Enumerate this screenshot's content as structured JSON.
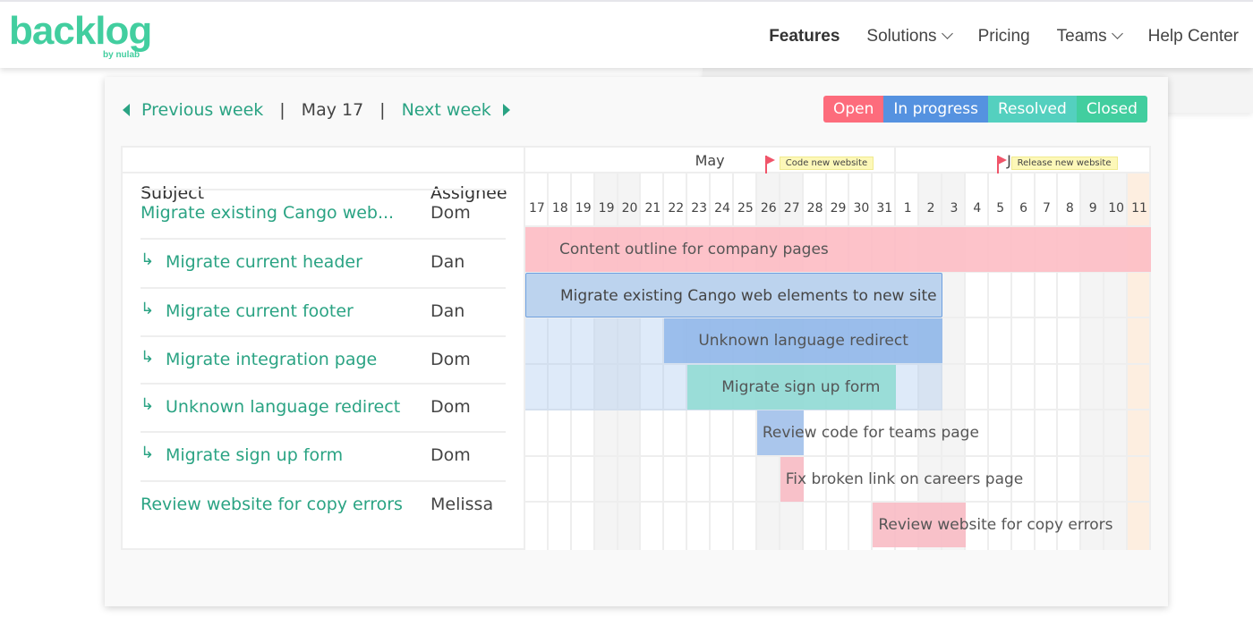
{
  "header": {
    "logo": "backlog",
    "logo_sub": "by nulab",
    "nav": [
      {
        "label": "Features",
        "bold": true
      },
      {
        "label": "Solutions",
        "dropdown": true
      },
      {
        "label": "Pricing"
      },
      {
        "label": "Teams",
        "dropdown": true
      },
      {
        "label": "Help Center"
      }
    ]
  },
  "week_nav": {
    "prev": "Previous week",
    "current": "May 17",
    "next": "Next week",
    "sep": "|"
  },
  "legend": [
    {
      "label": "Open",
      "color": "#fd6c7c"
    },
    {
      "label": "In progress",
      "color": "#5592e0"
    },
    {
      "label": "Resolved",
      "color": "#54d0bf"
    },
    {
      "label": "Closed",
      "color": "#42ce9f"
    }
  ],
  "table": {
    "subject_header": "Subject",
    "assignee_header": "Assignee",
    "rows": [
      {
        "subject": "Migrate existing Cango web...",
        "assignee": "Dom",
        "child": false
      },
      {
        "subject": "Migrate current header",
        "assignee": "Dan",
        "child": true
      },
      {
        "subject": "Migrate current footer",
        "assignee": "Dan",
        "child": true
      },
      {
        "subject": "Migrate integration page",
        "assignee": "Dom",
        "child": true
      },
      {
        "subject": "Unknown language redirect",
        "assignee": "Dom",
        "child": true
      },
      {
        "subject": "Migrate sign up form",
        "assignee": "Dom",
        "child": true
      },
      {
        "subject": "Review website for copy errors",
        "assignee": "Melissa",
        "child": false
      }
    ]
  },
  "timeline": {
    "months": [
      {
        "label": "May",
        "columns": 16
      },
      {
        "label": "June",
        "columns": 11
      }
    ],
    "days": [
      17,
      18,
      19,
      19,
      20,
      21,
      22,
      23,
      24,
      25,
      26,
      27,
      28,
      29,
      30,
      31,
      1,
      2,
      3,
      4,
      5,
      6,
      7,
      8,
      9,
      10,
      11
    ],
    "weekend_columns": [
      "May 19b",
      "May 20",
      "May 26",
      "May 27",
      "Jun 2",
      "Jun 3",
      "Jun 9",
      "Jun 10"
    ],
    "today": "Jun 11",
    "milestones": [
      {
        "day": "May 26",
        "label": "Code new website"
      },
      {
        "day": "Jun 5",
        "label": "Release new website"
      }
    ],
    "bars": [
      {
        "label": "Content outline for company pages",
        "row": 0,
        "start": "May 17",
        "end": "Jun 11",
        "color": "#fdbcc4"
      },
      {
        "label": "Migrate existing Cango web elements to new site",
        "row": 1,
        "start": "May 17",
        "end": "Jun 2",
        "color": "#bcd3ee",
        "parent": true
      },
      {
        "label": "Unknown language redirect",
        "row": 2,
        "start": "May 22",
        "end": "Jun 2",
        "color": "#93b9ea"
      },
      {
        "label": "Migrate sign up form",
        "row": 3,
        "start": "May 23",
        "end": "May 31",
        "color": "#93dcd5"
      },
      {
        "label": "Review code for teams page",
        "row": 4,
        "start": "May 26",
        "end": "May 27",
        "color": "#a3c2ec"
      },
      {
        "label": "Fix broken link on careers page",
        "row": 5,
        "start": "May 27",
        "end": "May 27",
        "color": "#f9bcc5"
      },
      {
        "label": "Review website for copy errors",
        "row": 6,
        "start": "May 31",
        "end": "Jun 3",
        "color": "#f9bcc5"
      }
    ]
  }
}
